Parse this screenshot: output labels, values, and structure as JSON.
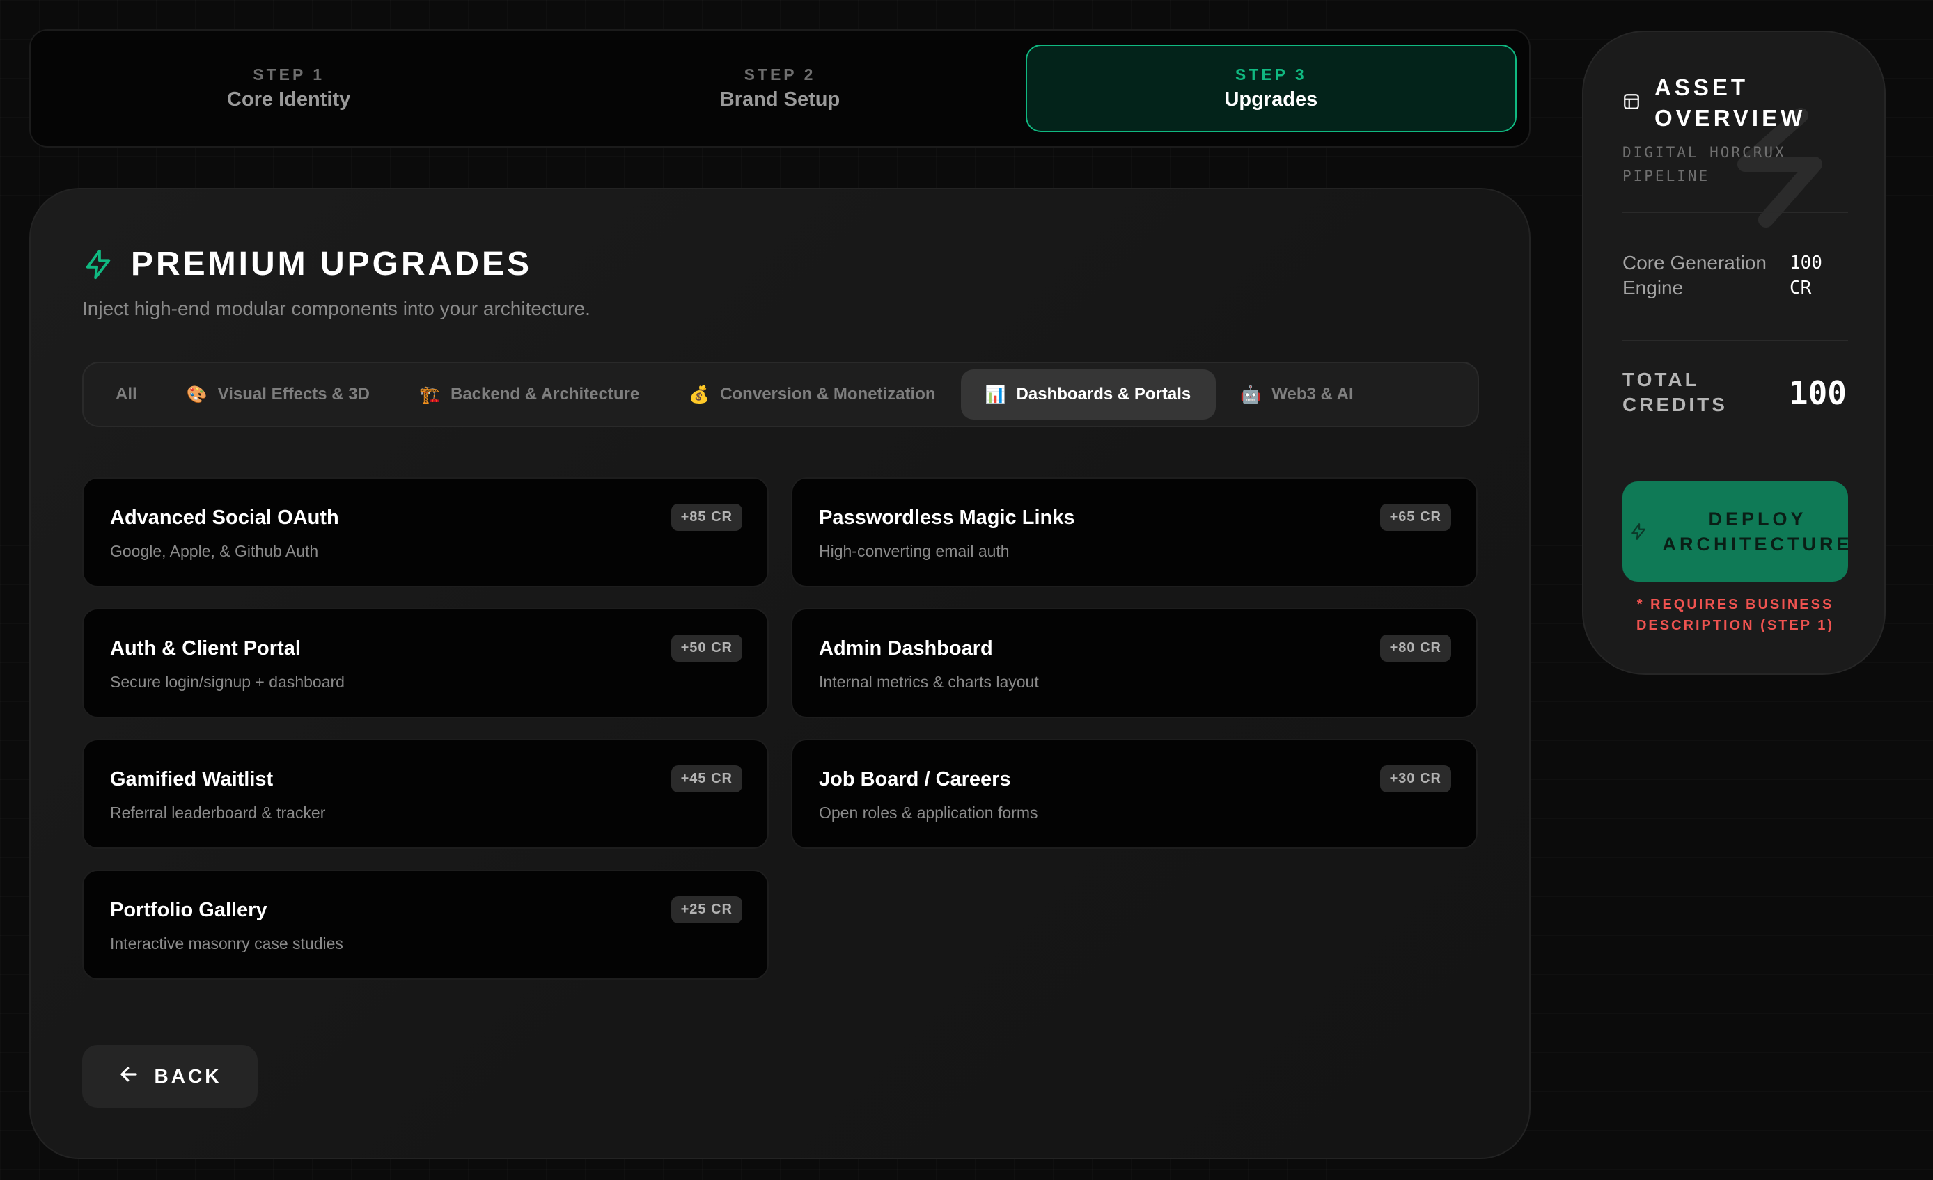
{
  "stepper": {
    "steps": [
      {
        "num": "STEP 1",
        "label": "Core Identity"
      },
      {
        "num": "STEP 2",
        "label": "Brand Setup"
      },
      {
        "num": "STEP 3",
        "label": "Upgrades"
      }
    ],
    "active_step": 3
  },
  "panel": {
    "title": "PREMIUM UPGRADES",
    "subtitle": "Inject high-end modular components into your architecture."
  },
  "tabs": [
    {
      "label": "All",
      "icon": ""
    },
    {
      "label": "Visual Effects & 3D",
      "icon": "🎨"
    },
    {
      "label": "Backend & Architecture",
      "icon": "🏗️"
    },
    {
      "label": "Conversion & Monetization",
      "icon": "💰"
    },
    {
      "label": "Dashboards & Portals",
      "icon": "📊"
    },
    {
      "label": "Web3 & AI",
      "icon": "🤖"
    }
  ],
  "active_tab": "Dashboards & Portals",
  "cards": [
    {
      "title": "Advanced Social OAuth",
      "desc": "Google, Apple, & Github Auth",
      "badge": "+85 CR"
    },
    {
      "title": "Passwordless Magic Links",
      "desc": "High-converting email auth",
      "badge": "+65 CR"
    },
    {
      "title": "Auth & Client Portal",
      "desc": "Secure login/signup + dashboard",
      "badge": "+50 CR"
    },
    {
      "title": "Admin Dashboard",
      "desc": "Internal metrics & charts layout",
      "badge": "+80 CR"
    },
    {
      "title": "Gamified Waitlist",
      "desc": "Referral leaderboard & tracker",
      "badge": "+45 CR"
    },
    {
      "title": "Job Board / Careers",
      "desc": "Open roles & application forms",
      "badge": "+30 CR"
    },
    {
      "title": "Portfolio Gallery",
      "desc": "Interactive masonry case studies",
      "badge": "+25 CR"
    }
  ],
  "back_button": {
    "label": "BACK"
  },
  "overview": {
    "title_line1": "ASSET",
    "title_line2": "OVERVIEW",
    "subtitle": "DIGITAL HORCRUX PIPELINE",
    "line_item_label": "Core Generation Engine",
    "line_item_value": "100 CR",
    "total_label": "TOTAL CREDITS",
    "total_value": "100",
    "deploy_label": "DEPLOY ARCHITECTURE",
    "warning": "* REQUIRES BUSINESS DESCRIPTION (STEP 1)"
  },
  "colors": {
    "accent": "#10b981",
    "deploy_bg": "#0f7a56",
    "warning": "#ef5350",
    "active_step_bg": "#03231a"
  },
  "icons": {
    "panel_title": "lightning-bolt-icon",
    "back": "arrow-left-icon",
    "overview": "layout-icon",
    "deploy": "lightning-bolt-icon"
  }
}
